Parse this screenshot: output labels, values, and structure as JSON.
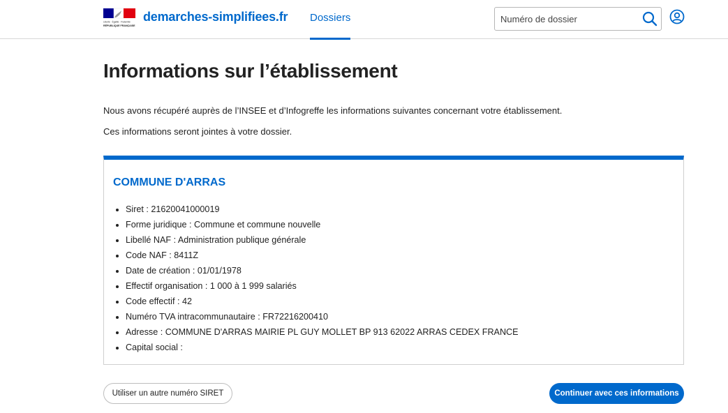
{
  "header": {
    "site_name": "demarches-simplifiees.fr",
    "nav_tab": "Dossiers",
    "search_placeholder": "Numéro de dossier",
    "logo_motto": "Liberté · Égalité · Fraternité",
    "logo_caption": "RÉPUBLIQUE FRANÇAISE"
  },
  "colors": {
    "accent": "#0069cc",
    "flag_blue": "#000091",
    "flag_red": "#e1000f"
  },
  "icons": {
    "search": "search-icon",
    "user": "user-circle-icon",
    "logo": "marianne-logo"
  },
  "page": {
    "title": "Informations sur l’établissement",
    "intro_1": "Nous avons récupéré auprès de l’INSEE et d’Infogreffe les informations suivantes concernant votre établissement.",
    "intro_2": "Ces informations seront jointes à votre dossier."
  },
  "establishment": {
    "name": "COMMUNE D'ARRAS",
    "items": [
      "Siret : 21620041000019",
      "Forme juridique : Commune et commune nouvelle",
      "Libellé NAF : Administration publique générale",
      "Code NAF : 8411Z",
      "Date de création : 01/01/1978",
      "Effectif organisation : 1 000 à 1 999 salariés",
      "Code effectif : 42",
      "Numéro TVA intracommunautaire : FR72216200410",
      "Adresse : COMMUNE D'ARRAS MAIRIE PL GUY MOLLET BP 913 62022 ARRAS CEDEX FRANCE",
      "Capital social :"
    ]
  },
  "actions": {
    "other_siret": "Utiliser un autre numéro SIRET",
    "continue": "Continuer avec ces informations"
  }
}
